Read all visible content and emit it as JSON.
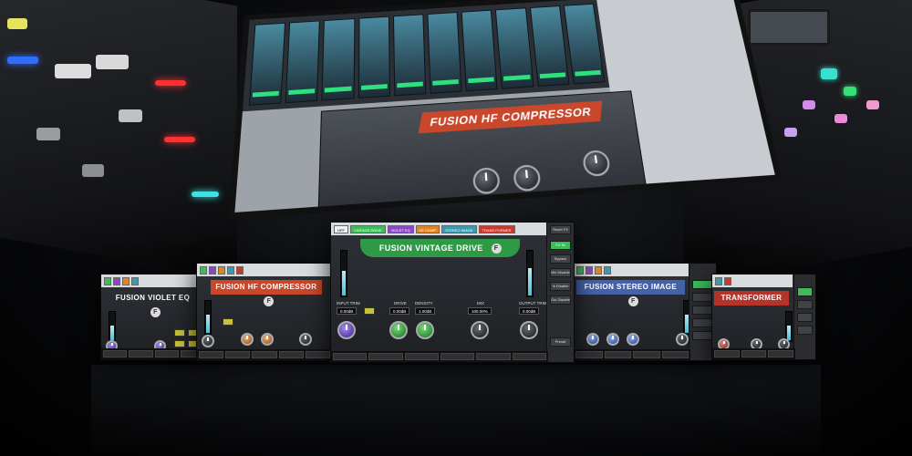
{
  "touchscreen": {
    "title": "FUSION HF COMPRESSOR"
  },
  "center_window": {
    "title": "FUSION VINTAGE DRIVE",
    "logo": "F",
    "chain": [
      "HPF",
      "VINTAGE DRIVE",
      "VIOLET EQ",
      "HF COMP",
      "STEREO IMAGE",
      "TRANS FORMER"
    ],
    "labels": {
      "input_trim": "INPUT TRIM",
      "drive": "DRIVE",
      "density": "DENSITY",
      "mix": "MIX",
      "output_trim": "OUTPUT TRIM"
    },
    "values": {
      "input_trim": "0.00dB",
      "drive": "0.00dB",
      "density": "1.00dB",
      "mix": "100.00%",
      "output_trim": "0.00dB"
    },
    "sidebar": [
      "Reset FX",
      "FX IN",
      "Bypass",
      "Mix Disable",
      "In Disable",
      "Out Disable"
    ],
    "preset_label": "Preset",
    "in_meter_level": 0.55,
    "out_meter_level": 0.6
  },
  "hf_window": {
    "title": "FUSION HF COMPRESSOR",
    "logo": "F"
  },
  "violet_window": {
    "title": "FUSION VIOLET EQ",
    "logo": "F"
  },
  "stereo_window": {
    "title": "FUSION STEREO IMAGE",
    "logo": "F"
  },
  "transformer_window": {
    "title": "TRANSFORMER"
  },
  "colors": {
    "red_band": "#c9472a",
    "violet_band": "#6b4fb5",
    "green_band": "#2f9a46",
    "blue_band": "#4562a8",
    "transformer_band": "#b3342b"
  }
}
